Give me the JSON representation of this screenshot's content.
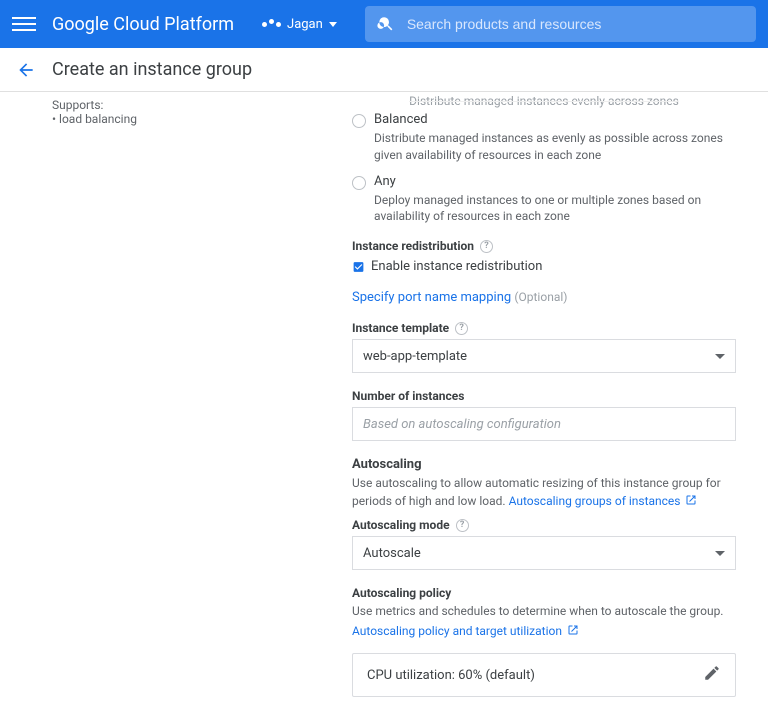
{
  "header": {
    "brand": "Google Cloud Platform",
    "project": "Jagan",
    "search_placeholder": "Search products and resources"
  },
  "page": {
    "title": "Create an instance group"
  },
  "sidebar": {
    "supports_label": "Supports:",
    "supports_items": [
      "load balancing"
    ]
  },
  "form": {
    "distribution_truncated": "Distribute managed instances evenly across zones",
    "radios": [
      {
        "label": "Balanced",
        "desc": "Distribute managed instances as evenly as possible across zones given availability of resources in each zone"
      },
      {
        "label": "Any",
        "desc": "Deploy managed instances to one or multiple zones based on availability of resources in each zone"
      }
    ],
    "redistribution": {
      "label": "Instance redistribution",
      "checkbox": "Enable instance redistribution"
    },
    "port_mapping": {
      "link": "Specify port name mapping",
      "optional": "(Optional)"
    },
    "instance_template": {
      "label": "Instance template",
      "value": "web-app-template"
    },
    "num_instances": {
      "label": "Number of instances",
      "placeholder": "Based on autoscaling configuration"
    },
    "autoscaling": {
      "heading": "Autoscaling",
      "desc": "Use autoscaling to allow automatic resizing of this instance group for periods of high and low load.",
      "link": "Autoscaling groups of instances"
    },
    "autoscaling_mode": {
      "label": "Autoscaling mode",
      "value": "Autoscale"
    },
    "autoscaling_policy": {
      "label": "Autoscaling policy",
      "desc": "Use metrics and schedules to determine when to autoscale the group.",
      "link": "Autoscaling policy and target utilization"
    },
    "policy_card": "CPU utilization: 60% (default)"
  }
}
